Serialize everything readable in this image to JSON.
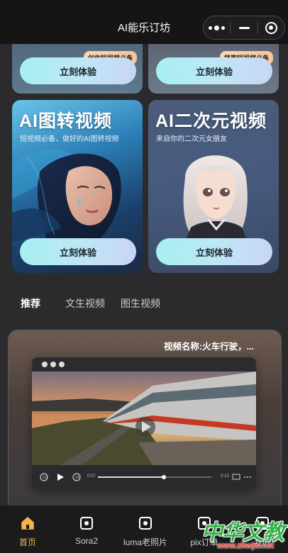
{
  "app": {
    "title": "AI能乐订坊"
  },
  "colors": {
    "accent_active": "#f3b54a",
    "button_gradient_start": "#a6f0f2",
    "button_gradient_end": "#c9d5f6",
    "badge_bg": "#f6d6b6"
  },
  "top_cards": [
    {
      "badge": "创作短视频必备",
      "button": "立刻体验"
    },
    {
      "badge": "搞笑短视频必备",
      "button": "立刻体验"
    }
  ],
  "feature_cards": [
    {
      "title": "AI图转视频",
      "subtitle": "短视频必备，做好的AI图转视频",
      "button": "立刻体验"
    },
    {
      "title": "AI二次元视频",
      "subtitle": "来自你的二次元女朋友",
      "button": "立刻体验"
    }
  ],
  "tabs": [
    {
      "label": "推荐",
      "active": true
    },
    {
      "label": "文生视频",
      "active": false
    },
    {
      "label": "图生视频",
      "active": false
    }
  ],
  "video": {
    "name": "视频名称:火车行驶，..."
  },
  "tabbar": [
    {
      "label": "首页",
      "icon": "home-icon",
      "active": true
    },
    {
      "label": "Sora2",
      "icon": "square-dot-icon",
      "active": false
    },
    {
      "label": "luma老照片",
      "icon": "square-dot-icon",
      "active": false
    },
    {
      "label": "pix订单",
      "icon": "square-dot-icon",
      "active": false
    },
    {
      "label": "我的",
      "icon": "square-dot-icon",
      "active": false
    }
  ],
  "watermark": {
    "main": "中华文教网",
    "url": "www.zhwjw.net"
  }
}
